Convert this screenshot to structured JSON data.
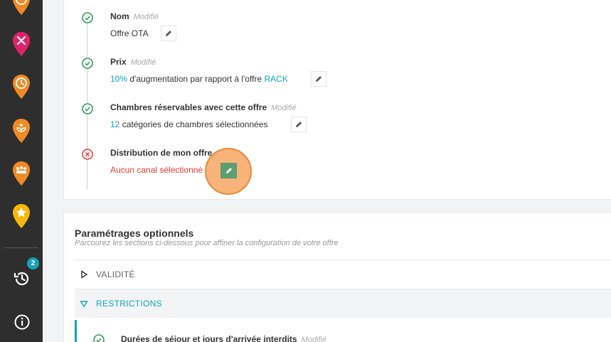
{
  "colors": {
    "accent": "#17a2b8",
    "error": "#e53935",
    "success": "#2e9e5b",
    "sidebar": "#2e2e2e",
    "pin_orange": "#f08a24",
    "pin_pink": "#e2216b",
    "pin_yellow": "#f5b80a"
  },
  "sidebar": {
    "items": [
      {
        "icon": "clock-pin-icon"
      },
      {
        "icon": "restaurant-pin-icon"
      },
      {
        "icon": "time-pin-icon"
      },
      {
        "icon": "spa-pin-icon"
      },
      {
        "icon": "group-pin-icon"
      },
      {
        "icon": "star-pin-icon"
      }
    ],
    "history_badge": "2",
    "bottom": [
      {
        "icon": "history-icon"
      },
      {
        "icon": "info-icon"
      }
    ]
  },
  "steps": [
    {
      "title": "Nom",
      "status": "Modifié",
      "value": "Offre OTA",
      "state": "done"
    },
    {
      "title": "Prix",
      "status": "Modifié",
      "value_highlight": "10%",
      "value_text": " d'augmentation par rapport à l'offre ",
      "value_highlight2": "RACK",
      "state": "done"
    },
    {
      "title": "Chambres réservables avec cette offre",
      "status": "Modifié",
      "value_highlight": "12",
      "value_text": " catégories de chambres sélectionnées",
      "state": "done"
    },
    {
      "title": "Distribution de mon offre",
      "value": "Aucun canal sélectionné",
      "state": "error"
    }
  ],
  "optional": {
    "title": "Paramétrages optionnels",
    "subtitle": "Parcourez les sections ci-dessous pour affiner la configuration de votre offre",
    "sections": [
      {
        "label": "VALIDITÉ",
        "expanded": false
      },
      {
        "label": "RESTRICTIONS",
        "expanded": true
      }
    ],
    "sub_item": {
      "title": "Durées de séjour et jours d'arrivée interdits",
      "status": "Modifié"
    }
  }
}
